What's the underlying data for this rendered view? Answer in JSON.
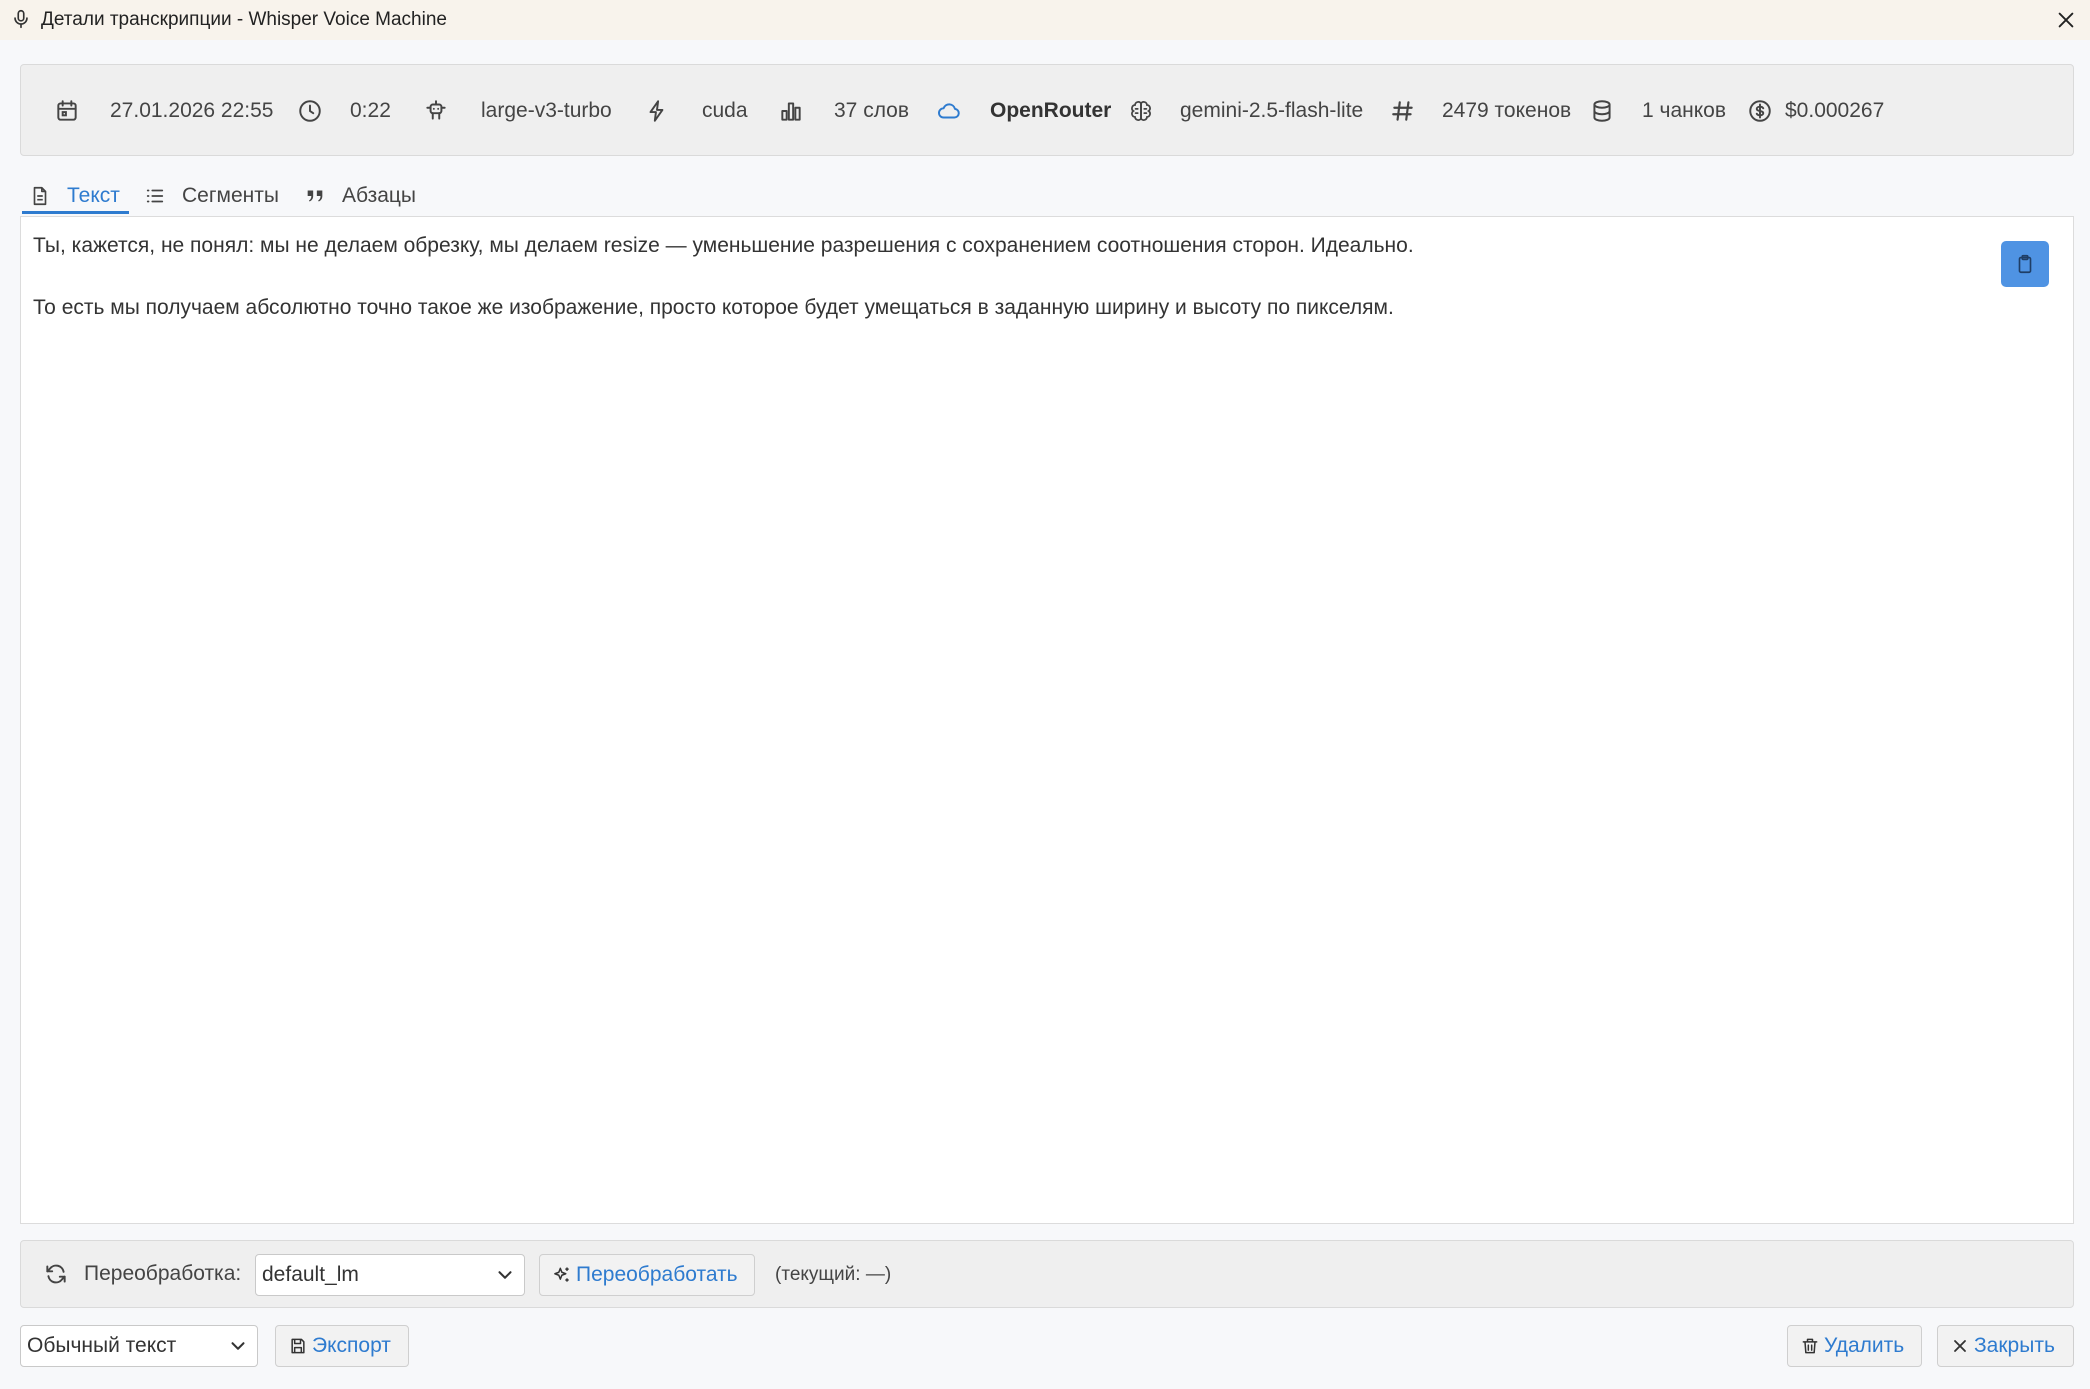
{
  "window": {
    "title": "Детали транскрипции - Whisper Voice Machine",
    "app_icon": "microphone-icon",
    "close_icon": "close-icon"
  },
  "info": {
    "datetime": "27.01.2026 22:55",
    "duration": "0:22",
    "model": "large-v3-turbo",
    "device": "cuda",
    "words": "37 слов",
    "provider": "OpenRouter",
    "llm_model": "gemini-2.5-flash-lite",
    "tokens": "2479 токенов",
    "chunks": "1 чанков",
    "cost": "$0.000267"
  },
  "tabs": [
    {
      "label": "Текст",
      "icon": "document-icon",
      "active": true
    },
    {
      "label": "Сегменты",
      "icon": "list-icon",
      "active": false
    },
    {
      "label": "Абзацы",
      "icon": "quote-icon",
      "active": false
    }
  ],
  "transcript": {
    "paragraphs": [
      "Ты, кажется, не понял: мы не делаем обрезку, мы делаем resize — уменьшение разрешения с сохранением соотношения сторон. Идеально.",
      "То есть мы получаем абсолютно точно такое же изображение, просто которое будет умещаться в заданную ширину и высоту по пикселям."
    ]
  },
  "reprocess": {
    "label": "Переобработка:",
    "selected_model": "default_lm",
    "button_label": "Переобработать",
    "current": "(текущий: —)"
  },
  "footer": {
    "format_selected": "Обычный текст",
    "export_label": "Экспорт",
    "delete_label": "Удалить",
    "close_label": "Закрыть"
  },
  "colors": {
    "accent": "#2e7bcf",
    "copy_button": "#4f93e3",
    "titlebar_bg": "#f8f3ec",
    "panel_bg": "#efefef"
  }
}
